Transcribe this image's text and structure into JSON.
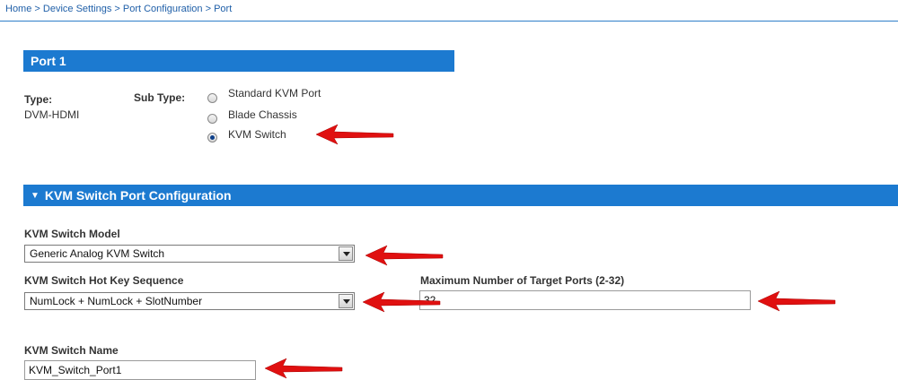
{
  "breadcrumb": {
    "items": [
      "Home",
      "Device Settings",
      "Port Configuration",
      "Port"
    ],
    "separator": ">"
  },
  "port_section": {
    "title": "Port 1",
    "type_label": "Type:",
    "type_value": "DVM-HDMI",
    "subtype_label": "Sub Type:",
    "subtype_options": [
      "Standard KVM Port",
      "Blade Chassis",
      "KVM Switch"
    ],
    "subtype_selected": "KVM Switch"
  },
  "kvm_section": {
    "title": "KVM Switch Port Configuration",
    "model_label": "KVM Switch Model",
    "model_value": "Generic Analog KVM Switch",
    "hotkey_label": "KVM Switch Hot Key Sequence",
    "hotkey_value": "NumLock + NumLock + SlotNumber",
    "max_ports_label": "Maximum Number of Target Ports (2-32)",
    "max_ports_value": "32",
    "name_label": "KVM Switch Name",
    "name_value": "KVM_Switch_Port1"
  },
  "colors": {
    "section_bar": "#1c7ad0",
    "breadcrumb_link": "#1f5fa8",
    "annotation_arrow": "#e01010"
  },
  "icons": [
    "collapse-triangle-icon",
    "dropdown-arrow-icon",
    "red-annotation-arrow-icon"
  ]
}
